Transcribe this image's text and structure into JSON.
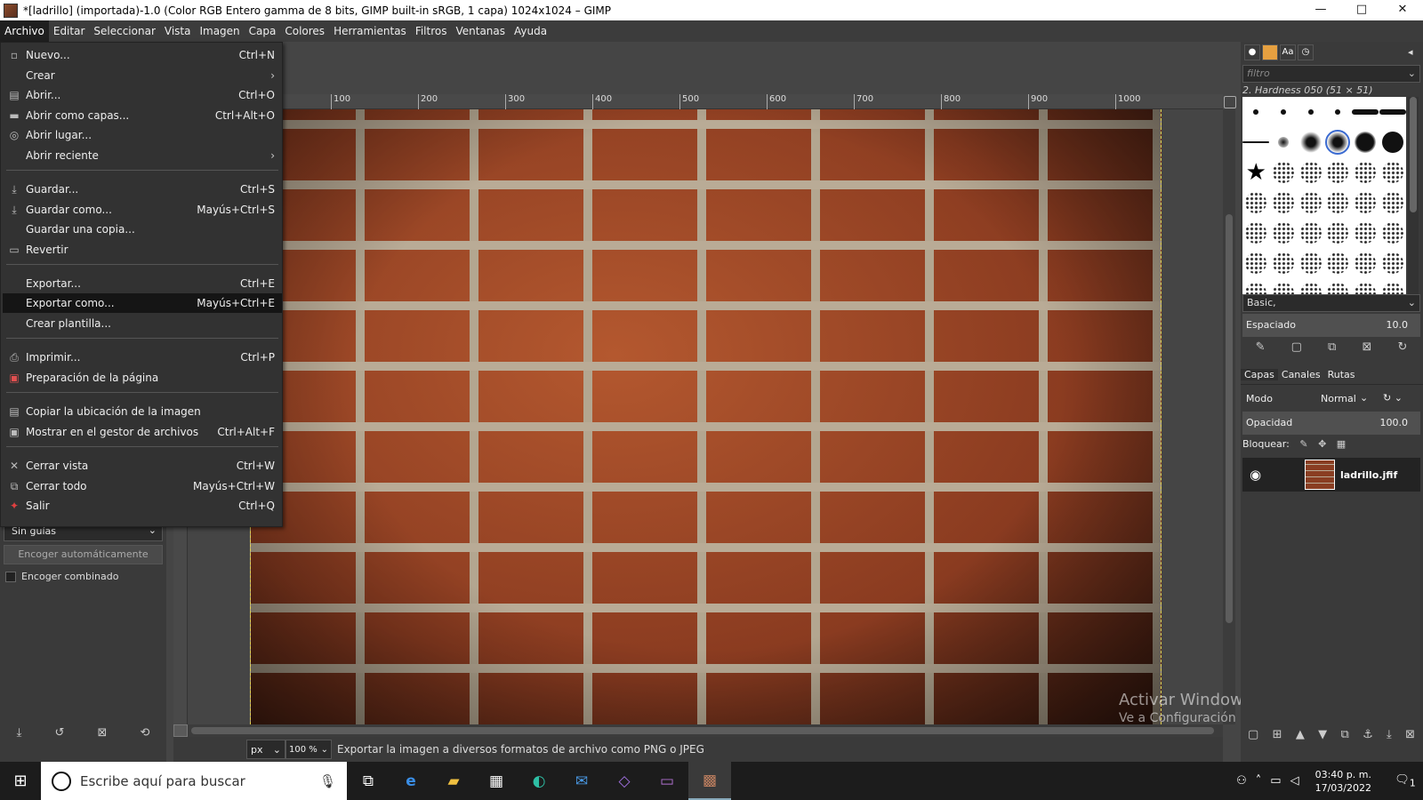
{
  "window": {
    "title": "*[ladrillo] (importada)-1.0 (Color RGB Entero gamma de 8 bits, GIMP built-in sRGB, 1 capa) 1024x1024 – GIMP",
    "minimize": "—",
    "maximize": "□",
    "close": "✕"
  },
  "menubar": [
    "Archivo",
    "Editar",
    "Seleccionar",
    "Vista",
    "Imagen",
    "Capa",
    "Colores",
    "Herramientas",
    "Filtros",
    "Ventanas",
    "Ayuda"
  ],
  "file_menu": {
    "items": [
      {
        "label": "Nuevo...",
        "shortcut": "Ctrl+N",
        "icon": "new-file-icon"
      },
      {
        "label": "Crear",
        "shortcut": "",
        "submenu": true,
        "icon": "none"
      },
      {
        "label": "Abrir...",
        "shortcut": "Ctrl+O",
        "icon": "open-icon"
      },
      {
        "label": "Abrir como capas...",
        "shortcut": "Ctrl+Alt+O",
        "icon": "open-layers-icon"
      },
      {
        "label": "Abrir lugar...",
        "shortcut": "",
        "icon": "globe-icon"
      },
      {
        "label": "Abrir reciente",
        "shortcut": "",
        "submenu": true,
        "icon": "none"
      },
      {
        "label": "Guardar...",
        "shortcut": "Ctrl+S",
        "icon": "save-icon"
      },
      {
        "label": "Guardar como...",
        "shortcut": "Mayús+Ctrl+S",
        "icon": "save-as-icon"
      },
      {
        "label": "Guardar una copia...",
        "shortcut": "",
        "icon": "none"
      },
      {
        "label": "Revertir",
        "shortcut": "",
        "icon": "revert-icon"
      },
      {
        "label": "Exportar...",
        "shortcut": "Ctrl+E",
        "icon": "none"
      },
      {
        "label": "Exportar como...",
        "shortcut": "Mayús+Ctrl+E",
        "icon": "none"
      },
      {
        "label": "Crear plantilla...",
        "shortcut": "",
        "icon": "none"
      },
      {
        "label": "Imprimir...",
        "shortcut": "Ctrl+P",
        "icon": "print-icon"
      },
      {
        "label": "Preparación de la página",
        "shortcut": "",
        "icon": "page-setup-icon"
      },
      {
        "label": "Copiar la ubicación de la imagen",
        "shortcut": "",
        "icon": "copy-location-icon"
      },
      {
        "label": "Mostrar en el gestor de archivos",
        "shortcut": "Ctrl+Alt+F",
        "icon": "file-manager-icon"
      },
      {
        "label": "Cerrar vista",
        "shortcut": "Ctrl+W",
        "icon": "close-view-icon"
      },
      {
        "label": "Cerrar todo",
        "shortcut": "Mayús+Ctrl+W",
        "icon": "close-all-icon"
      },
      {
        "label": "Salir",
        "shortcut": "Ctrl+Q",
        "icon": "quit-icon"
      }
    ]
  },
  "left_dock": {
    "guides_value": "Sin guías",
    "autoshrink_label": "Encoger automáticamente",
    "combined_label": "Encoger combinado"
  },
  "ruler": {
    "ticks": [
      "100",
      "200",
      "300",
      "400",
      "500",
      "600",
      "700",
      "800",
      "900",
      "1000"
    ]
  },
  "statusbar": {
    "unit": "px",
    "zoom": "100 %",
    "message": "Exportar la imagen a diversos formatos de archivo como PNG o JPEG"
  },
  "watermark": {
    "line1": "Activar Windows",
    "line2": "Ve a Configuración para activar Windows."
  },
  "brushes": {
    "filter_placeholder": "filtro",
    "selected_name": "2. Hardness 050 (51 × 51)",
    "tag": "Basic,",
    "spacing_label": "Espaciado",
    "spacing_value": "10.0"
  },
  "layers": {
    "tabs": [
      "Capas",
      "Canales",
      "Rutas"
    ],
    "mode_label": "Modo",
    "mode_value": "Normal",
    "opacity_label": "Opacidad",
    "opacity_value": "100.0",
    "lock_label": "Bloquear:",
    "layer_name": "ladrillo.jfif"
  },
  "taskbar": {
    "search_placeholder": "Escribe aquí para buscar",
    "time": "03:40 p. m.",
    "date": "17/03/2022",
    "notifications": "1"
  },
  "colors": {
    "accent": "#1f1f1f",
    "highlight": "#151515",
    "brick": "#8a3e22",
    "mortar": "#b9ab96"
  }
}
